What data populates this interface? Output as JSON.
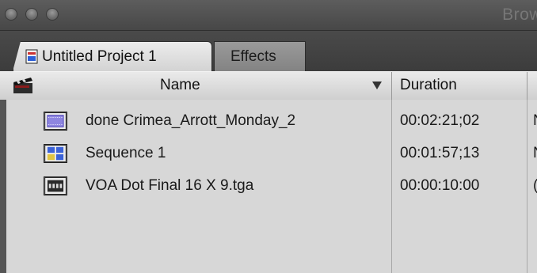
{
  "window": {
    "title": "Brow"
  },
  "tabs": [
    {
      "label": "Untitled Project 1",
      "active": true
    },
    {
      "label": "Effects",
      "active": false
    }
  ],
  "columns": {
    "name": "Name",
    "duration": "Duration"
  },
  "rows": [
    {
      "name": "done Crimea_Arrott_Monday_2",
      "duration": "00:02:21;02",
      "extra": "N",
      "icon": "clip-icon"
    },
    {
      "name": "Sequence 1",
      "duration": "00:01:57;13",
      "extra": "N",
      "icon": "sequence-icon"
    },
    {
      "name": "VOA Dot Final 16 X 9.tga",
      "duration": "00:00:10:00",
      "extra": "(",
      "icon": "still-image-icon"
    }
  ]
}
